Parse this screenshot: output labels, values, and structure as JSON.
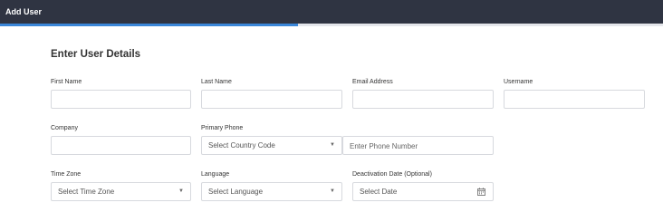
{
  "header": {
    "title": "Add User"
  },
  "progress": {
    "fraction": 0.45
  },
  "form": {
    "heading": "Enter User Details",
    "first_name": {
      "label": "First Name",
      "value": ""
    },
    "last_name": {
      "label": "Last Name",
      "value": ""
    },
    "email": {
      "label": "Email Address",
      "value": ""
    },
    "username": {
      "label": "Username",
      "value": ""
    },
    "company": {
      "label": "Company",
      "value": ""
    },
    "primary_phone": {
      "label": "Primary Phone",
      "country_placeholder": "Select Country Code",
      "number_placeholder": "Enter Phone Number"
    },
    "time_zone": {
      "label": "Time Zone",
      "placeholder": "Select Time Zone"
    },
    "language": {
      "label": "Language",
      "placeholder": "Select Language"
    },
    "deactivation_date": {
      "label": "Deactivation Date (Optional)",
      "placeholder": "Select Date"
    }
  },
  "icons": {
    "dropdown": "chevron-down-icon",
    "date": "calendar-icon"
  }
}
